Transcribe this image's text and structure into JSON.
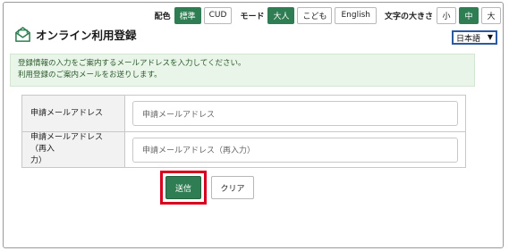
{
  "toolbar": {
    "color_label": "配色",
    "color_options": [
      "標準",
      "CUD"
    ],
    "mode_label": "モード",
    "mode_options": [
      "大人",
      "こども",
      "English"
    ],
    "size_label": "文字の大きさ",
    "size_options": [
      "小",
      "中",
      "大"
    ]
  },
  "header": {
    "title": "オンライン利用登録",
    "icon": "envelope-icon"
  },
  "language": {
    "selected": "日本語"
  },
  "info": {
    "line1": "登録情報の入力をご案内するメールアドレスを入力してください。",
    "line2": "利用登録のご案内メールをお送りします。"
  },
  "form": {
    "email_label": "申請メールアドレス",
    "email_placeholder": "申請メールアドレス",
    "email_confirm_label_1": "申請メールアドレス（再入",
    "email_confirm_label_2": "力）",
    "email_confirm_placeholder": "申請メールアドレス（再入力）"
  },
  "buttons": {
    "submit": "送信",
    "clear": "クリア"
  },
  "colors": {
    "accent_green": "#2f7d52",
    "highlight_red": "#d9001b",
    "info_bg": "#e8f5e8",
    "select_border": "#2c5aa0"
  }
}
